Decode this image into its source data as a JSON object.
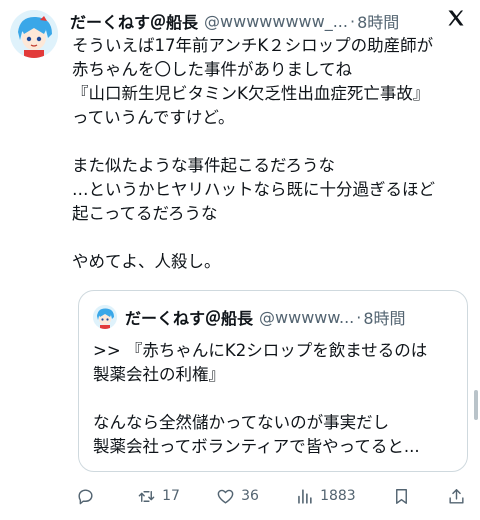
{
  "author": {
    "name": "だーくねす＠船長",
    "handle": "@wwwwwwww_...",
    "time": "8時間"
  },
  "tweet_lines": [
    "そういえば17年前アンチK２シロップの助産師が",
    "赤ちゃんを〇した事件がありましてね",
    "『山口新生児ビタミンK欠乏性出血症死亡事故』",
    "っていうんですけど。",
    "",
    "また似たような事件起こるだろうな",
    "…というかヒヤリハットなら既に十分過ぎるほど",
    "起こってるだろうな",
    "",
    "やめてよ、人殺し。"
  ],
  "quote": {
    "name": "だーくねす＠船長",
    "handle": "@wwwww...",
    "time": "8時間",
    "lines": [
      ">> 『赤ちゃんにK2シロップを飲ませるのは",
      "製薬会社の利権』",
      "",
      "なんなら全然儲かってないのが事実だし",
      "製薬会社ってボランティアで皆やってると..."
    ]
  },
  "actions": {
    "reply_count": "",
    "retweet_count": "17",
    "like_count": "36",
    "view_count": "1883"
  },
  "icons": [
    "x-logo-icon",
    "reply-icon",
    "retweet-icon",
    "like-icon",
    "views-icon",
    "bookmark-icon",
    "share-icon"
  ],
  "colors": {
    "text": "#0f1419",
    "muted": "#536471",
    "border": "#cfd9de"
  }
}
